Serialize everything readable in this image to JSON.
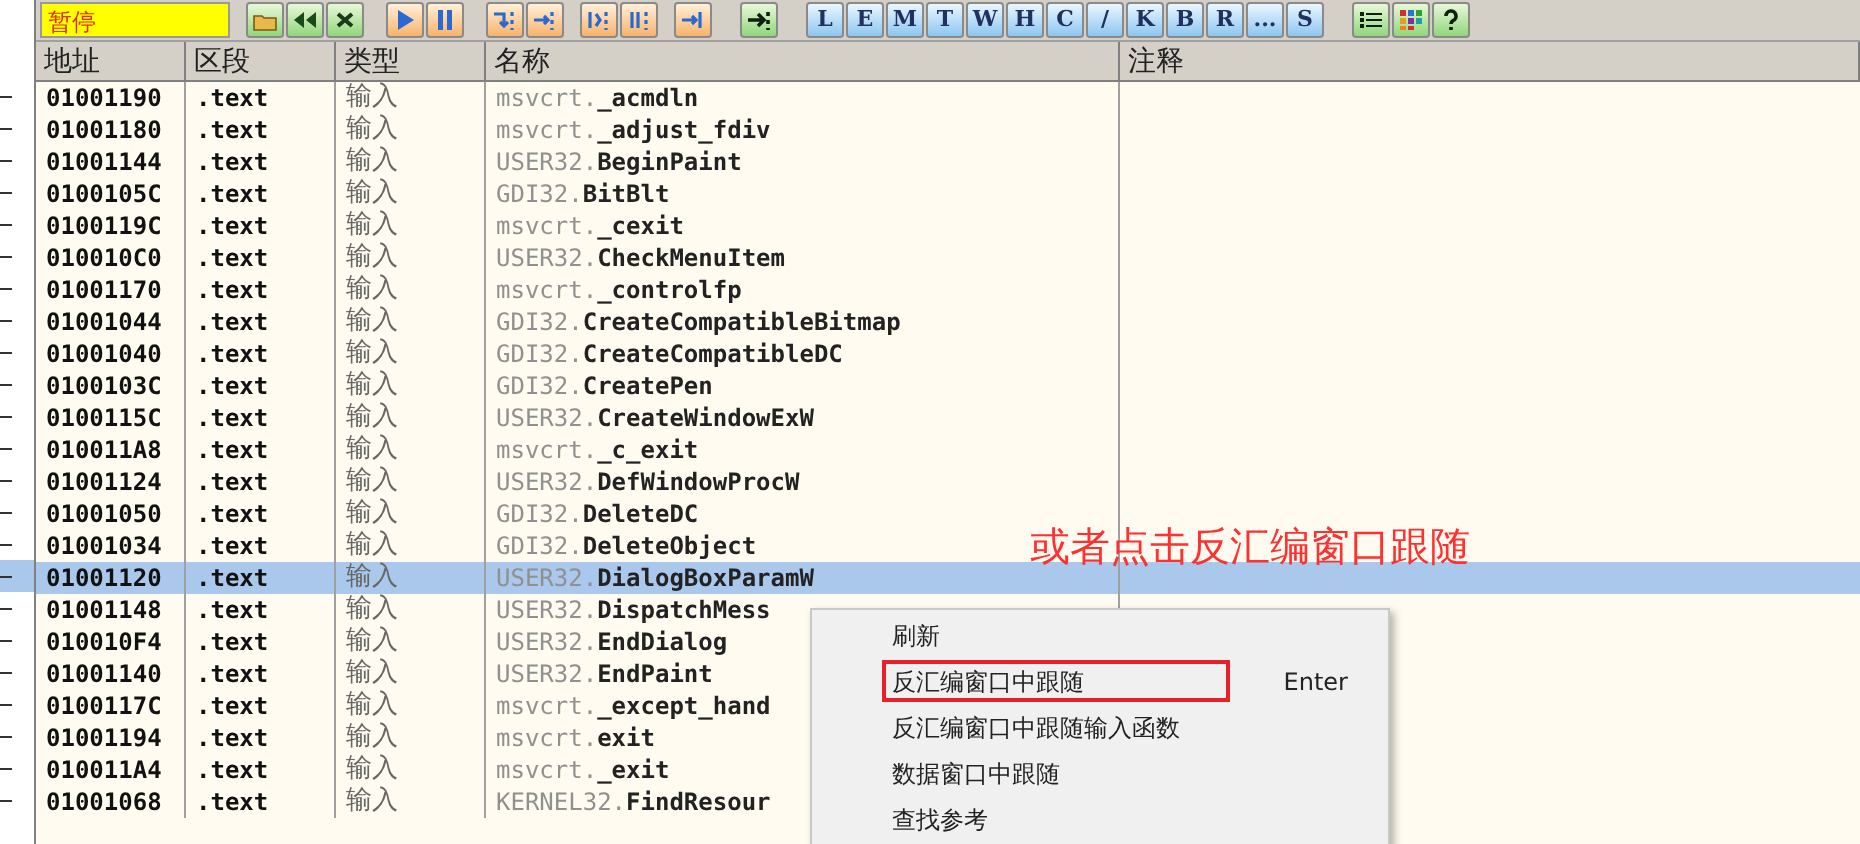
{
  "toolbar": {
    "status": "暂停",
    "letter_buttons": [
      "L",
      "E",
      "M",
      "T",
      "W",
      "H",
      "C",
      "/",
      "K",
      "B",
      "R",
      "...",
      "S"
    ]
  },
  "table": {
    "columns": [
      "地址",
      "区段",
      "类型",
      "名称",
      "注释"
    ],
    "rows": [
      {
        "address": "01001190",
        "section": ".text",
        "type": "输入",
        "module": "msvcrt.",
        "function": "_acmdln",
        "selected": false
      },
      {
        "address": "01001180",
        "section": ".text",
        "type": "输入",
        "module": "msvcrt.",
        "function": "_adjust_fdiv",
        "selected": false
      },
      {
        "address": "01001144",
        "section": ".text",
        "type": "输入",
        "module": "USER32.",
        "function": "BeginPaint",
        "selected": false
      },
      {
        "address": "0100105C",
        "section": ".text",
        "type": "输入",
        "module": "GDI32.",
        "function": "BitBlt",
        "selected": false
      },
      {
        "address": "0100119C",
        "section": ".text",
        "type": "输入",
        "module": "msvcrt.",
        "function": "_cexit",
        "selected": false
      },
      {
        "address": "010010C0",
        "section": ".text",
        "type": "输入",
        "module": "USER32.",
        "function": "CheckMenuItem",
        "selected": false
      },
      {
        "address": "01001170",
        "section": ".text",
        "type": "输入",
        "module": "msvcrt.",
        "function": "_controlfp",
        "selected": false
      },
      {
        "address": "01001044",
        "section": ".text",
        "type": "输入",
        "module": "GDI32.",
        "function": "CreateCompatibleBitmap",
        "selected": false
      },
      {
        "address": "01001040",
        "section": ".text",
        "type": "输入",
        "module": "GDI32.",
        "function": "CreateCompatibleDC",
        "selected": false
      },
      {
        "address": "0100103C",
        "section": ".text",
        "type": "输入",
        "module": "GDI32.",
        "function": "CreatePen",
        "selected": false
      },
      {
        "address": "0100115C",
        "section": ".text",
        "type": "输入",
        "module": "USER32.",
        "function": "CreateWindowExW",
        "selected": false
      },
      {
        "address": "010011A8",
        "section": ".text",
        "type": "输入",
        "module": "msvcrt.",
        "function": "_c_exit",
        "selected": false
      },
      {
        "address": "01001124",
        "section": ".text",
        "type": "输入",
        "module": "USER32.",
        "function": "DefWindowProcW",
        "selected": false
      },
      {
        "address": "01001050",
        "section": ".text",
        "type": "输入",
        "module": "GDI32.",
        "function": "DeleteDC",
        "selected": false
      },
      {
        "address": "01001034",
        "section": ".text",
        "type": "输入",
        "module": "GDI32.",
        "function": "DeleteObject",
        "selected": false
      },
      {
        "address": "01001120",
        "section": ".text",
        "type": "输入",
        "module": "USER32.",
        "function": "DialogBoxParamW",
        "selected": true
      },
      {
        "address": "01001148",
        "section": ".text",
        "type": "输入",
        "module": "USER32.",
        "function": "DispatchMess",
        "selected": false
      },
      {
        "address": "010010F4",
        "section": ".text",
        "type": "输入",
        "module": "USER32.",
        "function": "EndDialog",
        "selected": false
      },
      {
        "address": "01001140",
        "section": ".text",
        "type": "输入",
        "module": "USER32.",
        "function": "EndPaint",
        "selected": false
      },
      {
        "address": "0100117C",
        "section": ".text",
        "type": "输入",
        "module": "msvcrt.",
        "function": "_except_hand",
        "selected": false
      },
      {
        "address": "01001194",
        "section": ".text",
        "type": "输入",
        "module": "msvcrt.",
        "function": "exit",
        "selected": false
      },
      {
        "address": "010011A4",
        "section": ".text",
        "type": "输入",
        "module": "msvcrt.",
        "function": "_exit",
        "selected": false
      },
      {
        "address": "01001068",
        "section": ".text",
        "type": "输入",
        "module": "KERNEL32.",
        "function": "FindResour",
        "selected": false
      }
    ]
  },
  "annotation": "或者点击反汇编窗口跟随",
  "context_menu": {
    "items": [
      {
        "label": "刷新",
        "highlighted": false
      },
      {
        "label": "反汇编窗口中跟随",
        "shortcut": "Enter",
        "highlighted": true
      },
      {
        "label": "反汇编窗口中跟随输入函数",
        "highlighted": false
      },
      {
        "label": "数据窗口中跟随",
        "highlighted": false
      },
      {
        "label": "查找参考",
        "highlighted": false
      }
    ]
  }
}
